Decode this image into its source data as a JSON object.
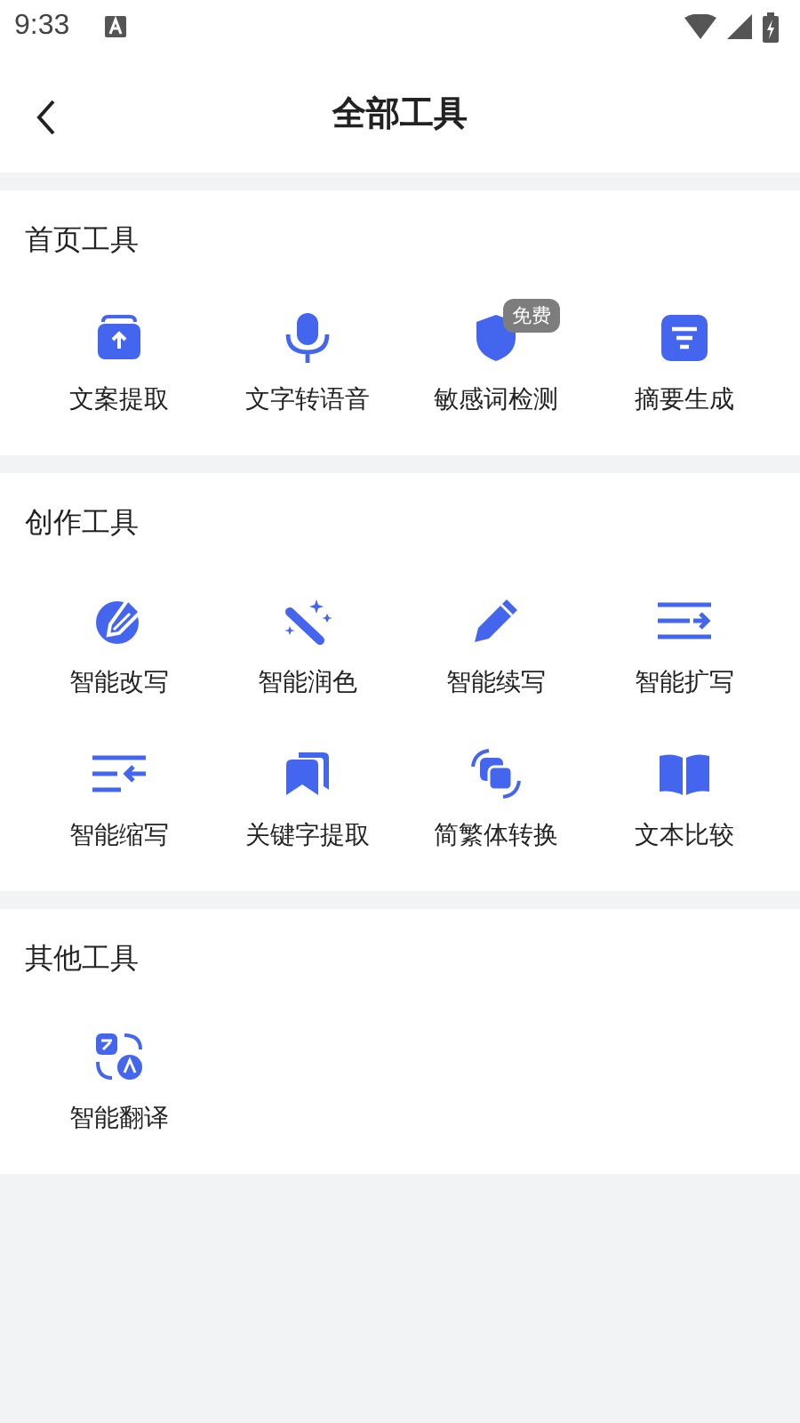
{
  "status_bar": {
    "time": "9:33"
  },
  "header": {
    "title": "全部工具"
  },
  "sections": [
    {
      "title": "首页工具",
      "tools": [
        {
          "label": "文案提取"
        },
        {
          "label": "文字转语音"
        },
        {
          "label": "敏感词检测",
          "badge": "免费"
        },
        {
          "label": "摘要生成"
        }
      ]
    },
    {
      "title": "创作工具",
      "tools": [
        {
          "label": "智能改写"
        },
        {
          "label": "智能润色"
        },
        {
          "label": "智能续写"
        },
        {
          "label": "智能扩写"
        },
        {
          "label": "智能缩写"
        },
        {
          "label": "关键字提取"
        },
        {
          "label": "简繁体转换"
        },
        {
          "label": "文本比较"
        }
      ]
    },
    {
      "title": "其他工具",
      "tools": [
        {
          "label": "智能翻译"
        }
      ]
    }
  ]
}
